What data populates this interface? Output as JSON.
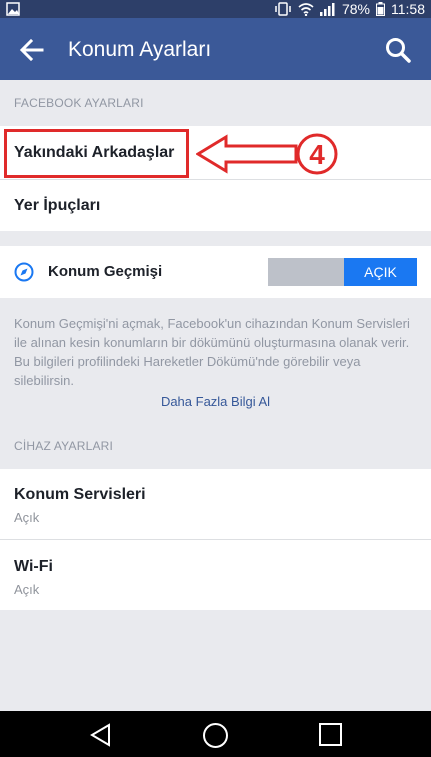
{
  "status_bar": {
    "battery_percent": "78%",
    "time": "11:58",
    "icons": [
      "image-icon",
      "vibrate-icon",
      "wifi-icon",
      "signal-icon",
      "battery-icon"
    ]
  },
  "app_bar": {
    "title": "Konum Ayarları",
    "back_icon": "back-arrow-icon",
    "search_icon": "search-icon"
  },
  "facebook_settings": {
    "header": "FACEBOOK AYARLARI",
    "items": [
      {
        "label": "Yakındaki Arkadaşlar"
      },
      {
        "label": "Yer İpuçları"
      }
    ]
  },
  "annotation": {
    "step_number": "4",
    "color": "#e02a2a"
  },
  "location_history": {
    "label": "Konum Geçmişi",
    "icon": "compass-icon",
    "toggle_label": "AÇIK",
    "toggle_on": true,
    "description": "Konum Geçmişi'ni açmak, Facebook'un cihazından Konum Servisleri ile alınan kesin konumların bir dökümünü oluşturmasına olanak verir. Bu bilgileri profilindeki Hareketler Dökümü'nde görebilir veya silebilirsin.",
    "more_link": "Daha Fazla Bilgi Al"
  },
  "device_settings": {
    "header": "CİHAZ AYARLARI",
    "items": [
      {
        "label": "Konum Servisleri",
        "value": "Açık"
      },
      {
        "label": "Wi-Fi",
        "value": "Açık"
      }
    ]
  },
  "nav_bar": {
    "icons": [
      "nav-back-icon",
      "nav-home-icon",
      "nav-recents-icon"
    ]
  },
  "colors": {
    "brand": "#3b5998",
    "status_bar": "#2d3f69",
    "toggle_on": "#1a78f2",
    "link": "#365899"
  }
}
